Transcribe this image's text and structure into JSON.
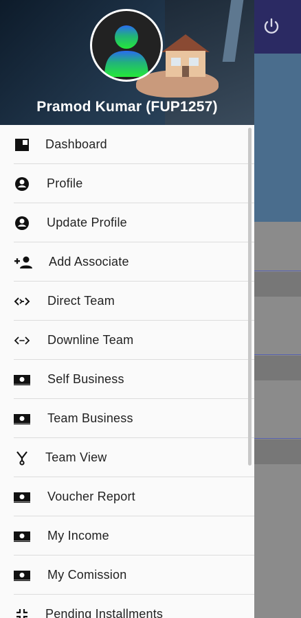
{
  "user": {
    "name": "Pramod Kumar (FUP1257)"
  },
  "topbar": {
    "power_icon": "power-icon"
  },
  "menu": {
    "items": [
      {
        "label": "Dashboard",
        "icon": "dashboard-icon"
      },
      {
        "label": "Profile",
        "icon": "account-circle-icon"
      },
      {
        "label": "Update Profile",
        "icon": "account-circle-icon"
      },
      {
        "label": "Add Associate",
        "icon": "person-add-icon"
      },
      {
        "label": "Direct Team",
        "icon": "code-arrows-icon"
      },
      {
        "label": "Downline Team",
        "icon": "code-dots-icon"
      },
      {
        "label": "Self Business",
        "icon": "money-icon"
      },
      {
        "label": "Team Business",
        "icon": "money-icon"
      },
      {
        "label": "Team View",
        "icon": "tree-fork-icon"
      },
      {
        "label": "Voucher Report",
        "icon": "money-icon"
      },
      {
        "label": "My Income",
        "icon": "money-icon"
      },
      {
        "label": "My Comission",
        "icon": "money-icon"
      },
      {
        "label": "Pending Installments",
        "icon": "collapse-icon"
      }
    ]
  }
}
